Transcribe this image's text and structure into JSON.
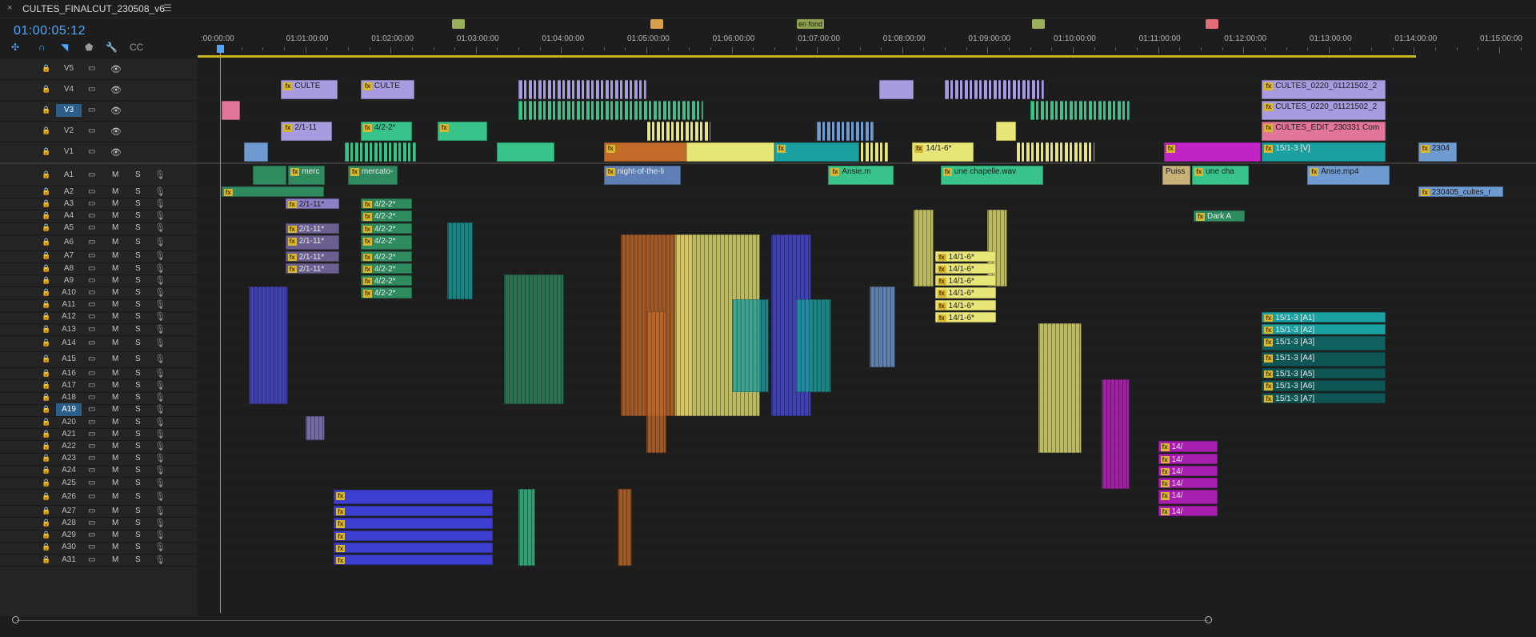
{
  "window": {
    "close_glyph": "×",
    "title": "CULTES_FINALCUT_230508_v6",
    "menu_glyph": "☰"
  },
  "timecode": "01:00:05:12",
  "ruler": {
    "labels": [
      ":00:00:00",
      "01:01:00:00",
      "01:02:00:00",
      "01:03:00:00",
      "01:04:00:00",
      "01:05:00:00",
      "01:06:00:00",
      "01:07:00:00",
      "01:08:00:00",
      "01:09:00:00",
      "01:10:00:00",
      "01:11:00:00",
      "01:12:00:00",
      "01:13:00:00",
      "01:14:00:00",
      "01:15:00:00"
    ]
  },
  "markers": [
    {
      "label": "",
      "color": "#9aae5b"
    },
    {
      "label": "",
      "color": "#d9a04c"
    },
    {
      "label": "en fond",
      "color": "#8ea24e"
    },
    {
      "label": "",
      "color": "#9aae5b"
    },
    {
      "label": "",
      "color": "#e26d79"
    }
  ],
  "colors": {
    "accent": "#4fa6ff",
    "work_area": "#c8b41e"
  },
  "tools": [
    {
      "name": "snap-icon",
      "glyph": "✣",
      "active": true
    },
    {
      "name": "linked-selection-icon",
      "glyph": "∩",
      "active": true
    },
    {
      "name": "add-marker-icon",
      "glyph": "◥",
      "active": true
    },
    {
      "name": "marker-icon",
      "glyph": "⬟",
      "active": false
    },
    {
      "name": "wrench-icon",
      "glyph": "🔧",
      "active": false
    },
    {
      "name": "captions-icon",
      "glyph": "CC",
      "active": false
    }
  ],
  "header_glyphs": {
    "lock": "🔒",
    "film": "▭",
    "eye": "👁",
    "mute": "M",
    "solo": "S",
    "mic": "🎙"
  },
  "tracks": [
    {
      "id": "V5",
      "kind": "video"
    },
    {
      "id": "V4",
      "kind": "video"
    },
    {
      "id": "V3",
      "kind": "video",
      "active": true
    },
    {
      "id": "V2",
      "kind": "video"
    },
    {
      "id": "V1",
      "kind": "video"
    },
    {
      "id": "A1",
      "kind": "audio"
    },
    {
      "id": "A2",
      "kind": "audio"
    },
    {
      "id": "A3",
      "kind": "audio"
    },
    {
      "id": "A4",
      "kind": "audio"
    },
    {
      "id": "A5",
      "kind": "audio"
    },
    {
      "id": "A6",
      "kind": "audio"
    },
    {
      "id": "A7",
      "kind": "audio"
    },
    {
      "id": "A8",
      "kind": "audio"
    },
    {
      "id": "A9",
      "kind": "audio"
    },
    {
      "id": "A10",
      "kind": "audio"
    },
    {
      "id": "A11",
      "kind": "audio"
    },
    {
      "id": "A12",
      "kind": "audio"
    },
    {
      "id": "A13",
      "kind": "audio"
    },
    {
      "id": "A14",
      "kind": "audio"
    },
    {
      "id": "A15",
      "kind": "audio"
    },
    {
      "id": "A16",
      "kind": "audio"
    },
    {
      "id": "A17",
      "kind": "audio"
    },
    {
      "id": "A18",
      "kind": "audio"
    },
    {
      "id": "A19",
      "kind": "audio",
      "active": true
    },
    {
      "id": "A20",
      "kind": "audio"
    },
    {
      "id": "A21",
      "kind": "audio"
    },
    {
      "id": "A22",
      "kind": "audio"
    },
    {
      "id": "A23",
      "kind": "audio"
    },
    {
      "id": "A24",
      "kind": "audio"
    },
    {
      "id": "A25",
      "kind": "audio"
    },
    {
      "id": "A26",
      "kind": "audio"
    },
    {
      "id": "A27",
      "kind": "audio"
    },
    {
      "id": "A28",
      "kind": "audio"
    },
    {
      "id": "A29",
      "kind": "audio"
    },
    {
      "id": "A30",
      "kind": "audio"
    },
    {
      "id": "A31",
      "kind": "audio"
    }
  ],
  "clips": [
    {
      "track": "V4",
      "label": "CULTE",
      "color": "#a99be0",
      "tc": "01:00:43:00",
      "dur_s": 40,
      "fx": true
    },
    {
      "track": "V4",
      "label": "CULTE",
      "color": "#a99be0",
      "tc": "01:01:39:00",
      "dur_s": 38,
      "fx": true
    },
    {
      "track": "V4",
      "label": "",
      "color": "#a99be0",
      "tc": "01:07:44:00",
      "dur_s": 24,
      "fx": false
    },
    {
      "track": "V4",
      "label": "CULTES_0220_01121502_2",
      "color": "#a99be0",
      "tc": "01:12:13:00",
      "dur_s": 87,
      "fx": true
    },
    {
      "track": "V3",
      "label": "",
      "color": "#e1769a",
      "tc": "01:00:01:00",
      "dur_s": 13,
      "fx": false
    },
    {
      "track": "V3",
      "label": "CULTES_0220_01121502_2",
      "color": "#a99be0",
      "tc": "01:12:13:00",
      "dur_s": 87,
      "fx": true
    },
    {
      "track": "V2",
      "label": "2/1-11",
      "color": "#a99be0",
      "tc": "01:00:43:00",
      "dur_s": 36,
      "fx": true
    },
    {
      "track": "V2",
      "label": "4/2-2*",
      "color": "#37c38a",
      "tc": "01:01:39:00",
      "dur_s": 36,
      "fx": true
    },
    {
      "track": "V2",
      "label": "",
      "color": "#37c38a",
      "tc": "01:02:33:00",
      "dur_s": 35,
      "fx": true
    },
    {
      "track": "V2",
      "label": "",
      "color": "#e8e676",
      "tc": "01:09:06:00",
      "dur_s": 14,
      "fx": false
    },
    {
      "track": "V2",
      "label": "CULTES_EDIT_230331 Com",
      "color": "#e1769a",
      "tc": "01:12:13:00",
      "dur_s": 87,
      "fx": true
    },
    {
      "track": "V1",
      "label": "",
      "color": "#6f9bd1",
      "tc": "01:00:17:00",
      "dur_s": 17,
      "fx": false
    },
    {
      "track": "V1",
      "label": "",
      "color": "#37c38a",
      "tc": "01:03:15:00",
      "dur_s": 40,
      "fx": false
    },
    {
      "track": "V1",
      "label": "",
      "color": "#c46b2a",
      "tc": "01:04:30:00",
      "dur_s": 66,
      "fx": true
    },
    {
      "track": "V1",
      "label": "",
      "color": "#e8e676",
      "tc": "01:05:28:00",
      "dur_s": 62,
      "fx": false
    },
    {
      "track": "V1",
      "label": "",
      "color": "#1aa0a0",
      "tc": "01:06:30:00",
      "dur_s": 60,
      "fx": true
    },
    {
      "track": "V1",
      "label": "14/1-6*",
      "color": "#e8e676",
      "tc": "01:08:07:00",
      "dur_s": 43,
      "fx": true
    },
    {
      "track": "V1",
      "label": "",
      "color": "#c223c7",
      "tc": "01:11:04:00",
      "dur_s": 68,
      "fx": true
    },
    {
      "track": "V1",
      "label": "15/1-3 [V]",
      "color": "#1aa0a0",
      "tc": "01:12:13:00",
      "dur_s": 87,
      "fx": true
    },
    {
      "track": "V1",
      "label": "2304",
      "color": "#6f9bd1",
      "tc": "01:14:03:00",
      "dur_s": 27,
      "fx": true
    },
    {
      "track": "A1",
      "label": "",
      "color": "#2f8a5f",
      "tc": "01:00:23:00",
      "dur_s": 24,
      "fx": false
    },
    {
      "track": "A1",
      "label": "merc",
      "color": "#2f8a5f",
      "tc": "01:00:48:00",
      "dur_s": 26,
      "fx": true
    },
    {
      "track": "A1",
      "label": "mercato-",
      "color": "#2f8a5f",
      "tc": "01:01:30:00",
      "dur_s": 35,
      "fx": true
    },
    {
      "track": "A1",
      "label": "night-of-the-li",
      "color": "#5d7fb5",
      "tc": "01:04:30:00",
      "dur_s": 54,
      "fx": true
    },
    {
      "track": "A1",
      "label": "Ansie.m",
      "color": "#37c38a",
      "tc": "01:07:08:00",
      "dur_s": 46,
      "fx": true
    },
    {
      "track": "A1",
      "label": "une chapelle.wav",
      "color": "#37c38a",
      "tc": "01:08:27:00",
      "dur_s": 72,
      "fx": true
    },
    {
      "track": "A1",
      "label": "Puiss",
      "color": "#c8b27a",
      "tc": "01:11:03:00",
      "dur_s": 20,
      "fx": false
    },
    {
      "track": "A1",
      "label": "une cha",
      "color": "#37c38a",
      "tc": "01:11:24:00",
      "dur_s": 40,
      "fx": true
    },
    {
      "track": "A1",
      "label": "Ansie.mp4",
      "color": "#6f9bd1",
      "tc": "01:12:45:00",
      "dur_s": 58,
      "fx": true
    },
    {
      "track": "A2",
      "label": "",
      "color": "#2f8a5f",
      "tc": "01:00:01:00",
      "dur_s": 72,
      "fx": true
    },
    {
      "track": "A2",
      "label": "230405_cultes_r",
      "color": "#6f9bd1",
      "tc": "01:14:03:00",
      "dur_s": 60,
      "fx": true
    },
    {
      "track": "A3",
      "label": "2/1-11*",
      "color": "#8d7fc7",
      "tc": "01:00:46:00",
      "dur_s": 38,
      "fx": true
    },
    {
      "track": "A3",
      "label": "4/2-2*",
      "color": "#2f8a5f",
      "tc": "01:01:39:00",
      "dur_s": 36,
      "fx": true
    },
    {
      "track": "A4",
      "label": "4/2-2*",
      "color": "#2f8a5f",
      "tc": "01:01:39:00",
      "dur_s": 36,
      "fx": true
    },
    {
      "track": "A4",
      "label": "Dark A",
      "color": "#2f8a5f",
      "tc": "01:11:25:00",
      "dur_s": 36,
      "fx": true
    },
    {
      "track": "A5",
      "label": "2/1-11*",
      "color": "#6a5f8f",
      "tc": "01:00:46:00",
      "dur_s": 38,
      "fx": true
    },
    {
      "track": "A5",
      "label": "4/2-2*",
      "color": "#2f8a5f",
      "tc": "01:01:39:00",
      "dur_s": 36,
      "fx": true
    },
    {
      "track": "A6",
      "label": "2/1-11*",
      "color": "#6a5f8f",
      "tc": "01:00:46:00",
      "dur_s": 38,
      "fx": true
    },
    {
      "track": "A6",
      "label": "4/2-2*",
      "color": "#2f8a5f",
      "tc": "01:01:39:00",
      "dur_s": 36,
      "fx": true
    },
    {
      "track": "A7",
      "label": "2/1-11*",
      "color": "#6a5f8f",
      "tc": "01:00:46:00",
      "dur_s": 38,
      "fx": true
    },
    {
      "track": "A7",
      "label": "4/2-2*",
      "color": "#2f8a5f",
      "tc": "01:01:39:00",
      "dur_s": 36,
      "fx": true
    },
    {
      "track": "A7",
      "label": "14/1-6*",
      "color": "#e8e676",
      "tc": "01:08:23:00",
      "dur_s": 43,
      "fx": true
    },
    {
      "track": "A8",
      "label": "2/1-11*",
      "color": "#6a5f8f",
      "tc": "01:00:46:00",
      "dur_s": 38,
      "fx": true
    },
    {
      "track": "A8",
      "label": "4/2-2*",
      "color": "#2f8a5f",
      "tc": "01:01:39:00",
      "dur_s": 36,
      "fx": true
    },
    {
      "track": "A8",
      "label": "14/1-6*",
      "color": "#e8e676",
      "tc": "01:08:23:00",
      "dur_s": 43,
      "fx": true
    },
    {
      "track": "A9",
      "label": "4/2-2*",
      "color": "#2f8a5f",
      "tc": "01:01:39:00",
      "dur_s": 36,
      "fx": true
    },
    {
      "track": "A9",
      "label": "14/1-6*",
      "color": "#e8e676",
      "tc": "01:08:23:00",
      "dur_s": 43,
      "fx": true
    },
    {
      "track": "A10",
      "label": "4/2-2*",
      "color": "#2f8a5f",
      "tc": "01:01:39:00",
      "dur_s": 36,
      "fx": true
    },
    {
      "track": "A10",
      "label": "14/1-6*",
      "color": "#e8e676",
      "tc": "01:08:23:00",
      "dur_s": 43,
      "fx": true
    },
    {
      "track": "A11",
      "label": "14/1-6*",
      "color": "#e8e676",
      "tc": "01:08:23:00",
      "dur_s": 43,
      "fx": true
    },
    {
      "track": "A12",
      "label": "14/1-6*",
      "color": "#e8e676",
      "tc": "01:08:23:00",
      "dur_s": 43,
      "fx": true
    },
    {
      "track": "A12",
      "label": "15/1-3 [A1]",
      "color": "#1aa0a0",
      "tc": "01:12:13:00",
      "dur_s": 87,
      "fx": true
    },
    {
      "track": "A13",
      "label": "15/1-3 [A2]",
      "color": "#1aa0a0",
      "tc": "01:12:13:00",
      "dur_s": 87,
      "fx": true
    },
    {
      "track": "A14",
      "label": "15/1-3 [A3]",
      "color": "#106060",
      "tc": "01:12:13:00",
      "dur_s": 87,
      "fx": true
    },
    {
      "track": "A15",
      "label": "15/1-3 [A4]",
      "color": "#0f5555",
      "tc": "01:12:13:00",
      "dur_s": 87,
      "fx": true
    },
    {
      "track": "A16",
      "label": "15/1-3 [A5]",
      "color": "#0f5555",
      "tc": "01:12:13:00",
      "dur_s": 87,
      "fx": true
    },
    {
      "track": "A17",
      "label": "15/1-3 [A6]",
      "color": "#0f5555",
      "tc": "01:12:13:00",
      "dur_s": 87,
      "fx": true
    },
    {
      "track": "A18",
      "label": "15/1-3 [A7]",
      "color": "#0f5555",
      "tc": "01:12:13:00",
      "dur_s": 87,
      "fx": true
    },
    {
      "track": "A22",
      "label": "14/",
      "color": "#a81fb0",
      "tc": "01:11:00:00",
      "dur_s": 42,
      "fx": true
    },
    {
      "track": "A23",
      "label": "14/",
      "color": "#a81fb0",
      "tc": "01:11:00:00",
      "dur_s": 42,
      "fx": true
    },
    {
      "track": "A24",
      "label": "14/",
      "color": "#a81fb0",
      "tc": "01:11:00:00",
      "dur_s": 42,
      "fx": true
    },
    {
      "track": "A25",
      "label": "14/",
      "color": "#a81fb0",
      "tc": "01:11:00:00",
      "dur_s": 42,
      "fx": true
    },
    {
      "track": "A26",
      "label": "14/",
      "color": "#a81fb0",
      "tc": "01:11:00:00",
      "dur_s": 42,
      "fx": true
    },
    {
      "track": "A27",
      "label": "14/",
      "color": "#a81fb0",
      "tc": "01:11:00:00",
      "dur_s": 42,
      "fx": true
    },
    {
      "track": "A26",
      "label": "",
      "color": "#3d3fd0",
      "tc": "01:01:20:00",
      "dur_s": 112,
      "fx": true
    },
    {
      "track": "A27",
      "label": "",
      "color": "#3d3fd0",
      "tc": "01:01:20:00",
      "dur_s": 112,
      "fx": true
    },
    {
      "track": "A28",
      "label": "",
      "color": "#3d3fd0",
      "tc": "01:01:20:00",
      "dur_s": 112,
      "fx": true
    },
    {
      "track": "A29",
      "label": "",
      "color": "#3d3fd0",
      "tc": "01:01:20:00",
      "dur_s": 112,
      "fx": true
    },
    {
      "track": "A30",
      "label": "",
      "color": "#3d3fd0",
      "tc": "01:01:20:00",
      "dur_s": 112,
      "fx": true
    },
    {
      "track": "A31",
      "label": "",
      "color": "#3d3fd0",
      "tc": "01:01:20:00",
      "dur_s": 112,
      "fx": true
    }
  ],
  "stripes": [
    {
      "track": "V1",
      "tc": "01:01:28:00",
      "dur_s": 50,
      "color": "#37c38a"
    },
    {
      "track": "V1",
      "tc": "01:05:25:00",
      "dur_s": 20,
      "color": "#e8e676"
    },
    {
      "track": "V1",
      "tc": "01:07:20:00",
      "dur_s": 30,
      "color": "#e8e676"
    },
    {
      "track": "V1",
      "tc": "01:09:20:00",
      "dur_s": 55,
      "color": "#e8e676"
    },
    {
      "track": "V2",
      "tc": "01:05:00:00",
      "dur_s": 45,
      "color": "#e8e676"
    },
    {
      "track": "V2",
      "tc": "01:07:00:00",
      "dur_s": 40,
      "color": "#6f9bd1"
    },
    {
      "track": "V4",
      "tc": "01:03:30:00",
      "dur_s": 90,
      "color": "#a99be0"
    },
    {
      "track": "V4",
      "tc": "01:08:30:00",
      "dur_s": 70,
      "color": "#a99be0"
    },
    {
      "track": "V3",
      "tc": "01:03:30:00",
      "dur_s": 130,
      "color": "#37c38a"
    },
    {
      "track": "V3",
      "tc": "01:09:30:00",
      "dur_s": 70,
      "color": "#37c38a"
    }
  ],
  "columns": [
    {
      "tc": "01:03:20:00",
      "dur_s": 42,
      "from": "A9",
      "to": "A18",
      "color": "#2f8a5f"
    },
    {
      "tc": "01:04:42:00",
      "dur_s": 50,
      "from": "A6",
      "to": "A19",
      "color": "#c46b2a"
    },
    {
      "tc": "01:05:20:00",
      "dur_s": 60,
      "from": "A6",
      "to": "A19",
      "color": "#e8e676"
    },
    {
      "tc": "01:06:28:00",
      "dur_s": 28,
      "from": "A6",
      "to": "A19",
      "color": "#4b4bd8"
    },
    {
      "tc": "01:06:45:00",
      "dur_s": 25,
      "from": "A11",
      "to": "A17",
      "color": "#1aa0a0"
    },
    {
      "tc": "01:06:00:00",
      "dur_s": 26,
      "from": "A11",
      "to": "A17",
      "color": "#1aa0a0"
    },
    {
      "tc": "01:09:36:00",
      "dur_s": 30,
      "from": "A13",
      "to": "A22",
      "color": "#e8e676"
    },
    {
      "tc": "01:10:20:00",
      "dur_s": 20,
      "from": "A17",
      "to": "A25",
      "color": "#c223c7"
    },
    {
      "tc": "01:02:40:00",
      "dur_s": 18,
      "from": "A5",
      "to": "A10",
      "color": "#1aa0a0"
    },
    {
      "tc": "01:05:00:00",
      "dur_s": 14,
      "from": "A12",
      "to": "A22",
      "color": "#c46b2a"
    },
    {
      "tc": "01:07:37:00",
      "dur_s": 18,
      "from": "A10",
      "to": "A15",
      "color": "#6f9bd1"
    },
    {
      "tc": "01:08:08:00",
      "dur_s": 14,
      "from": "A4",
      "to": "A9",
      "color": "#e8e676"
    },
    {
      "tc": "01:09:00:00",
      "dur_s": 14,
      "from": "A4",
      "to": "A9",
      "color": "#e8e676"
    },
    {
      "tc": "01:00:20:00",
      "dur_s": 28,
      "from": "A10",
      "to": "A18",
      "color": "#4b4bd8"
    },
    {
      "tc": "01:01:00:00",
      "dur_s": 14,
      "from": "A20",
      "to": "A21",
      "color": "#8d7fc7"
    },
    {
      "tc": "01:03:30:00",
      "dur_s": 12,
      "from": "A26",
      "to": "A31",
      "color": "#37c38a"
    },
    {
      "tc": "01:04:40:00",
      "dur_s": 10,
      "from": "A26",
      "to": "A31",
      "color": "#c46b2a"
    }
  ]
}
